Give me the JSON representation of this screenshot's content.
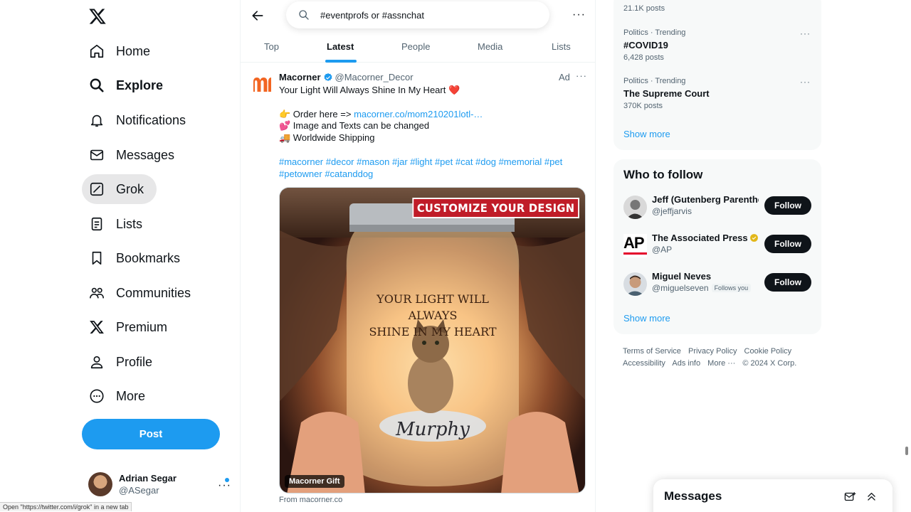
{
  "nav": {
    "items": [
      {
        "label": "Home",
        "icon": "home-icon"
      },
      {
        "label": "Explore",
        "icon": "search-icon"
      },
      {
        "label": "Notifications",
        "icon": "bell-icon"
      },
      {
        "label": "Messages",
        "icon": "envelope-icon"
      },
      {
        "label": "Grok",
        "icon": "grok-icon"
      },
      {
        "label": "Lists",
        "icon": "list-icon"
      },
      {
        "label": "Bookmarks",
        "icon": "bookmark-icon"
      },
      {
        "label": "Communities",
        "icon": "people-icon"
      },
      {
        "label": "Premium",
        "icon": "x-icon"
      },
      {
        "label": "Profile",
        "icon": "person-icon"
      },
      {
        "label": "More",
        "icon": "more-circle-icon"
      }
    ],
    "active": "Grok",
    "bold": "Explore",
    "post_label": "Post"
  },
  "user": {
    "name": "Adrian Segar",
    "handle": "@ASegar"
  },
  "status_bar": "Open \"https://twitter.com/i/grok\" in a new tab",
  "search": {
    "query": "#eventprofs or #assnchat"
  },
  "tabs": [
    "Top",
    "Latest",
    "People",
    "Media",
    "Lists"
  ],
  "active_tab": "Latest",
  "tweet": {
    "name": "Macorner",
    "handle": "@Macorner_Decor",
    "ad_label": "Ad",
    "line1": "Your Light Will Always Shine In My Heart ❤️",
    "order_prefix": "👉 Order here => ",
    "order_link": "macorner.co/mom210201lotl-…",
    "line3": "💕 Image and Texts can be changed",
    "line4": "🚚 Worldwide Shipping",
    "hashtags1": "#macorner #decor #mason #jar #light #pet #cat #dog #memorial #pet",
    "hashtags2": "#petowner #catanddog",
    "media_banner": "CUSTOMIZE YOUR DESIGN",
    "jar_line1": "YOUR LIGHT WILL ALWAYS",
    "jar_line2": "SHINE IN MY HEART",
    "jar_name": "Murphy",
    "media_tag": "Macorner Gift",
    "from": "From macorner.co"
  },
  "trends": {
    "top_count": "21.1K posts",
    "items": [
      {
        "meta": "Politics · Trending",
        "title": "#COVID19",
        "count": "6,428 posts"
      },
      {
        "meta": "Politics · Trending",
        "title": "The Supreme Court",
        "count": "370K posts"
      }
    ],
    "show_more": "Show more"
  },
  "who_to_follow": {
    "title": "Who to follow",
    "people": [
      {
        "name": "Jeff (Gutenberg Parenthe",
        "handle": "@jeffjarvis",
        "button": "Follow"
      },
      {
        "name": "The Associated Press",
        "handle": "@AP",
        "button": "Follow",
        "avatar_text": "AP"
      },
      {
        "name": "Miguel Neves",
        "handle": "@miguelseven",
        "follows_you": "Follows you",
        "button": "Follow"
      }
    ],
    "show_more": "Show more"
  },
  "footer": {
    "links1": [
      "Terms of Service",
      "Privacy Policy",
      "Cookie Policy"
    ],
    "links2": [
      "Accessibility",
      "Ads info",
      "More ···",
      "© 2024 X Corp."
    ]
  },
  "messages_drawer": {
    "title": "Messages"
  },
  "colors": {
    "accent": "#1d9bf0",
    "brand_orange": "#f26522",
    "ad_red": "#c01c28"
  }
}
